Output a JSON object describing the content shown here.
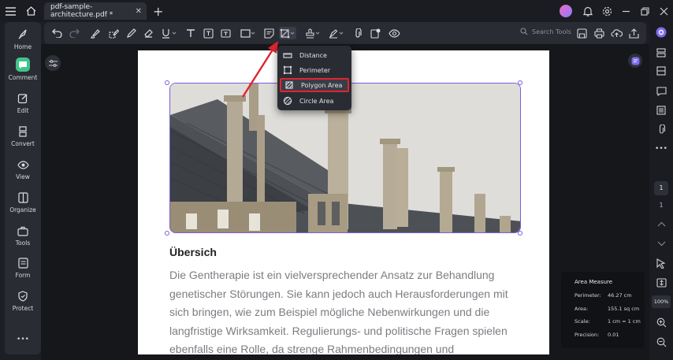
{
  "titlebar": {
    "tab_title": "pdf-sample-architecture.pdf *",
    "tab_close": "✕",
    "new_tab": "+"
  },
  "sidebar": {
    "items": [
      {
        "label": "Home"
      },
      {
        "label": "Comment"
      },
      {
        "label": "Edit"
      },
      {
        "label": "Convert"
      },
      {
        "label": "View"
      },
      {
        "label": "Organize"
      },
      {
        "label": "Tools"
      },
      {
        "label": "Form"
      },
      {
        "label": "Protect"
      }
    ],
    "more": "•••"
  },
  "toolbar": {
    "search_label": "Search Tools"
  },
  "measure_menu": {
    "items": [
      {
        "label": "Distance"
      },
      {
        "label": "Perimeter"
      },
      {
        "label": "Polygon Area"
      },
      {
        "label": "Circle Area"
      }
    ]
  },
  "document": {
    "heading": "Übersich",
    "paragraph": "Die Gentherapie ist ein vielversprechender Ansatz zur Behandlung genetischer Störungen. Sie kann jedoch auch Herausforderungen mit sich bringen, wie zum Beispiel mögliche Nebenwirkungen und die langfristige Wirksamkeit. Regulierungs- und politische Fragen spielen ebenfalls eine Rolle, da strenge Rahmenbedingungen und"
  },
  "right_panel": {
    "page_current": "1",
    "page_total": "1",
    "zoom": "100%"
  },
  "area_measure": {
    "title": "Area Measure",
    "perimeter_label": "Perimeter:",
    "perimeter_value": "46.27 cm",
    "area_label": "Area:",
    "area_value": "155.1 sq cm",
    "scale_label": "Scale:",
    "scale_value": "1 cm = 1 cm",
    "precision_label": "Precision:",
    "precision_value": "0.01"
  },
  "colors": {
    "accent": "#3fc58a",
    "selection": "#7b5fd6",
    "highlight": "#e0242f"
  }
}
